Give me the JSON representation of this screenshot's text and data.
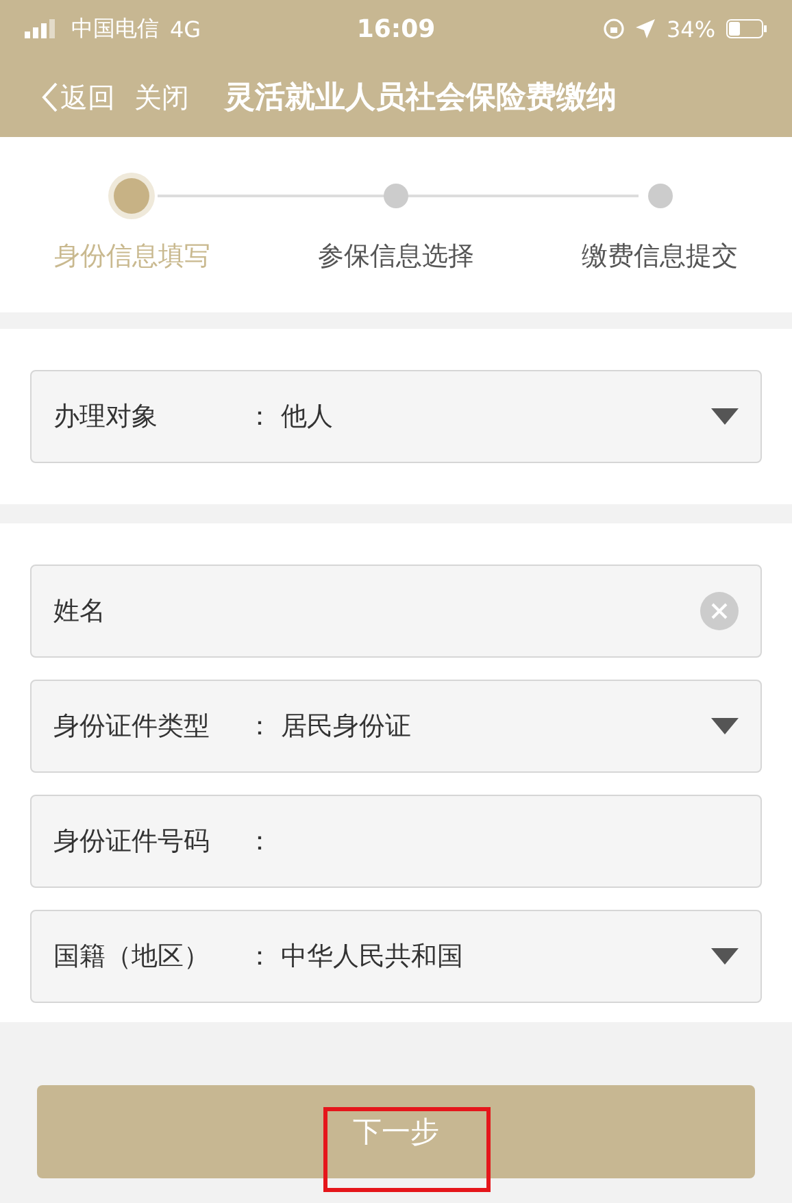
{
  "status_bar": {
    "carrier": "中国电信",
    "network": "4G",
    "time": "16:09",
    "battery": "34%"
  },
  "nav": {
    "back": "返回",
    "close": "关闭",
    "title": "灵活就业人员社会保险费缴纳"
  },
  "steps": [
    {
      "label": "身份信息填写",
      "selected": true
    },
    {
      "label": "参保信息选择",
      "selected": false
    },
    {
      "label": "缴费信息提交",
      "selected": false
    }
  ],
  "object_field": {
    "label": "办理对象",
    "separator": "：",
    "value": "他人",
    "kind": "select"
  },
  "fields": [
    {
      "label": "姓名",
      "kind": "text",
      "clearable": true
    },
    {
      "label": "身份证件类型",
      "separator": "：",
      "value": "居民身份证",
      "kind": "select"
    },
    {
      "label": "身份证件号码",
      "separator": "：",
      "kind": "text",
      "clearable": false
    },
    {
      "label": "国籍（地区）",
      "separator": "：",
      "value": "中华人民共和国",
      "kind": "select"
    }
  ],
  "next_button": {
    "label": "下一步",
    "highlighted": true
  }
}
